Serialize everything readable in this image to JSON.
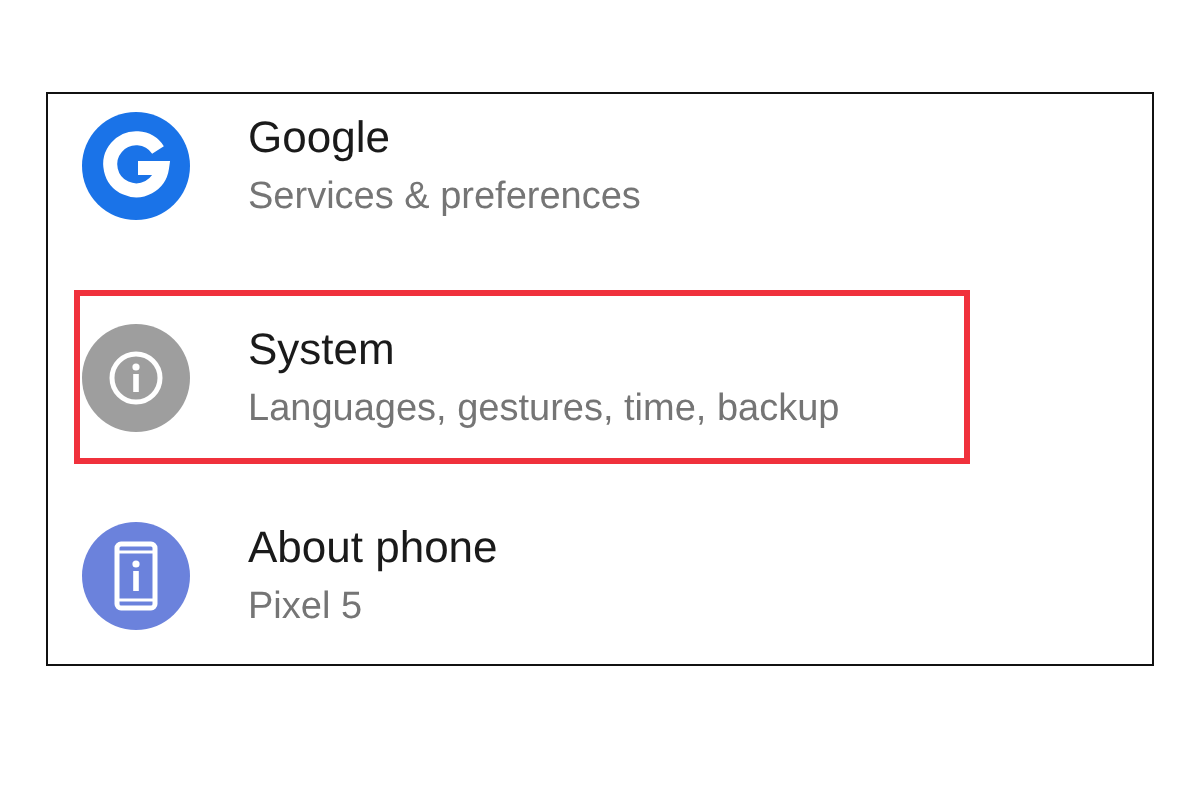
{
  "items": [
    {
      "kind": "google",
      "title": "Google",
      "subtitle": "Services & preferences",
      "highlighted": false
    },
    {
      "kind": "system",
      "title": "System",
      "subtitle": "Languages, gestures, time, backup",
      "highlighted": true
    },
    {
      "kind": "phone",
      "title": "About phone",
      "subtitle": "Pixel 5",
      "highlighted": false
    }
  ]
}
